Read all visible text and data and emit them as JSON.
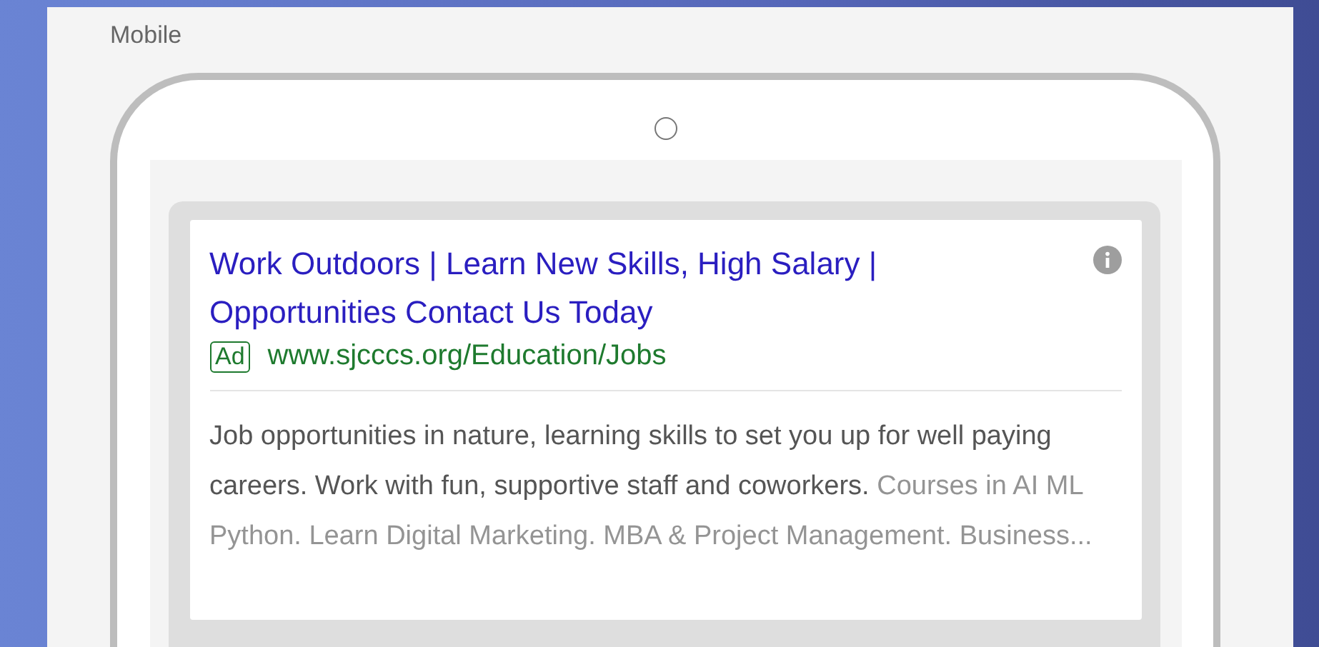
{
  "section_label": "Mobile",
  "ad": {
    "headline": "Work Outdoors | Learn New Skills, High Salary | Opportunities Contact Us Today",
    "badge": "Ad",
    "url": "www.sjcccs.org/Education/Jobs",
    "description": "Job opportunities in nature, learning skills to set you up for well paying careers. Work with fun, supportive staff and coworkers.",
    "extension": "Courses in AI ML Python. Learn Digital Marketing. MBA & Project Management. Business..."
  }
}
